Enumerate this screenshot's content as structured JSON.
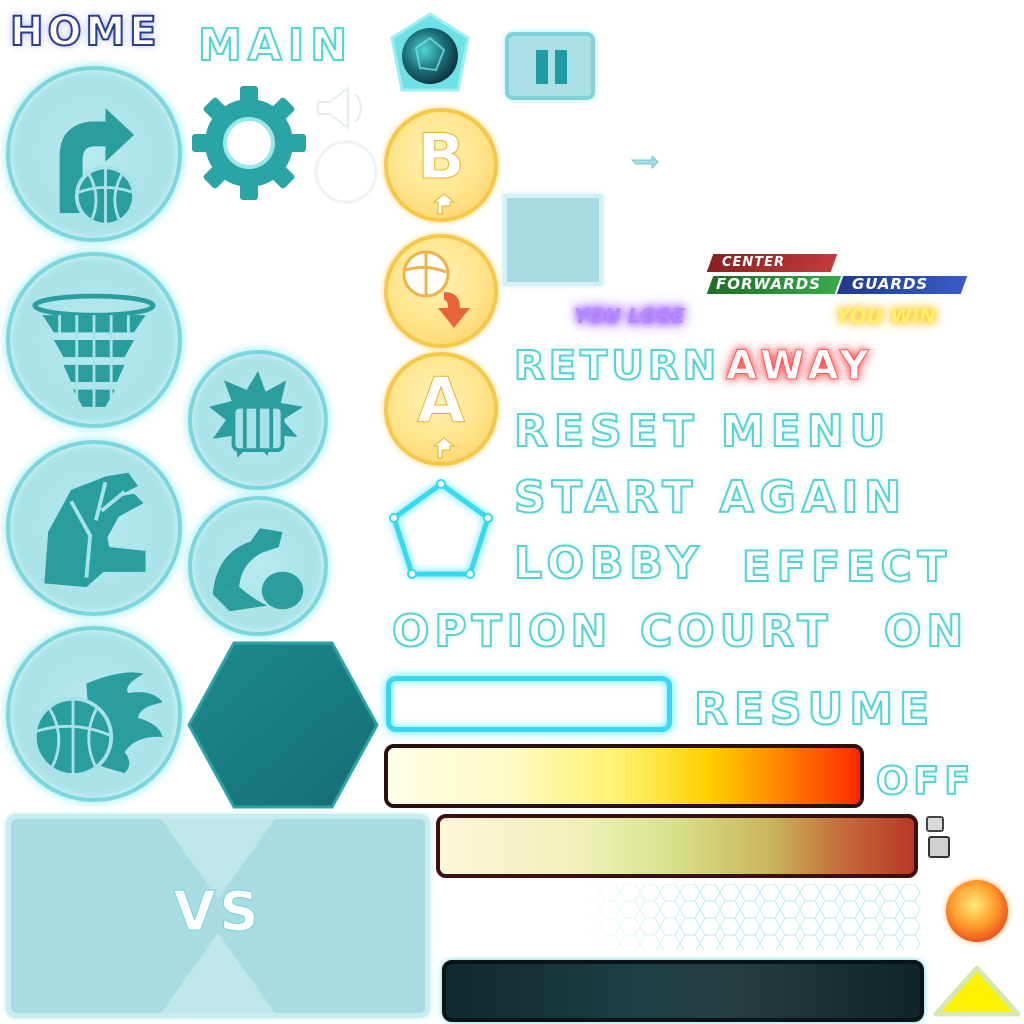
{
  "header": {
    "home_label": "HOME",
    "main_label": "MAIN"
  },
  "buttons": {
    "b_letter": "B",
    "a_letter": "A"
  },
  "team_tags": {
    "center": "CENTER",
    "forwards": "FORWARDS",
    "guards": "GUARDS"
  },
  "results": {
    "lose": "YOU LOSE",
    "win": "YOU WIN"
  },
  "menu_words": {
    "return": "RETURN",
    "away": "AWAY",
    "reset_menu": "RESET MENU",
    "start_again": "START AGAIN",
    "lobby": "LOBBY",
    "effect": "EFFECT",
    "option": "OPTION",
    "court": "COURT",
    "on": "ON",
    "resume": "RESUME",
    "off": "OFF"
  },
  "vs_panel": {
    "label": "VS"
  },
  "colors": {
    "teal_light": "#a7e2e8",
    "teal_dark": "#2a9e9e",
    "yellow": "#ffe38a",
    "accent_red": "#ff4040",
    "home_blue": "#2b3e8a"
  },
  "icons": [
    "shoot-icon",
    "gear-icon",
    "sound-icon",
    "gem-icon",
    "pause-icon",
    "net-icon",
    "fist-icon",
    "block-hand-icon",
    "muscle-icon",
    "fire-ball-icon",
    "pass-icon",
    "refresh-icon",
    "pentagon-frame-icon",
    "sun-orb-icon",
    "up-arrow-icon"
  ]
}
